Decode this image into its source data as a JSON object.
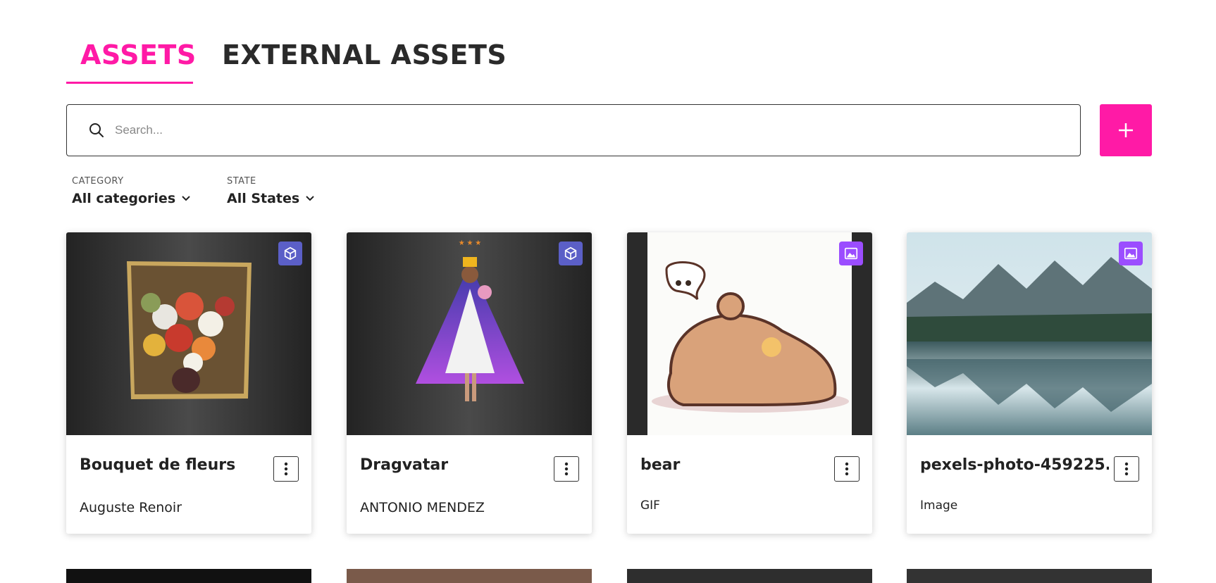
{
  "tabs": [
    {
      "label": "ASSETS",
      "active": true
    },
    {
      "label": "EXTERNAL ASSETS",
      "active": false
    }
  ],
  "search": {
    "placeholder": "Search...",
    "value": "",
    "icon": "search-icon"
  },
  "add_button": {
    "icon": "plus-icon"
  },
  "filters": {
    "category": {
      "label": "CATEGORY",
      "value": "All categories"
    },
    "state": {
      "label": "STATE",
      "value": "All States"
    }
  },
  "colors": {
    "accent": "#ff1aa6",
    "badge_3d": "#5b5fc7",
    "badge_image": "#9b4dff"
  },
  "cards": [
    {
      "title": "Bouquet de fleurs",
      "subtitle": "Auguste Renoir",
      "badge": "cube-3d-icon"
    },
    {
      "title": "Dragvatar",
      "subtitle": "ANTONIO MENDEZ",
      "badge": "cube-3d-icon"
    },
    {
      "title": "bear",
      "subtitle": "GIF",
      "badge": "image-icon"
    },
    {
      "title": "pexels-photo-459225....",
      "subtitle": "Image",
      "badge": "image-icon"
    }
  ]
}
